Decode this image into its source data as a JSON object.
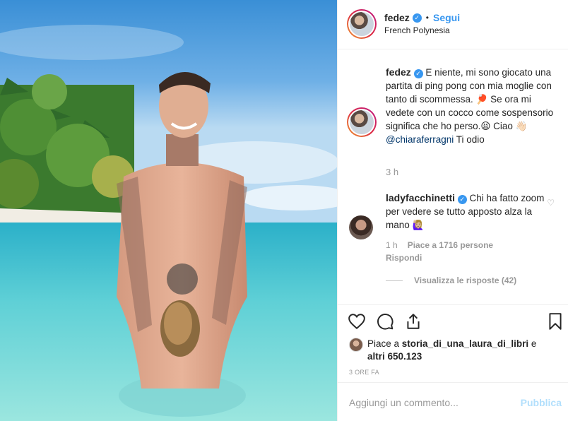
{
  "post": {
    "username": "fedez",
    "follow_label": "Segui",
    "location": "French Polynesia",
    "more_icon": "more-icon"
  },
  "caption": {
    "username": "fedez",
    "text": "E niente, mi sono giocato una partita di ping pong con mia moglie con tanto di scommessa. 🏓 Se ora mi vedete con un cocco come sospensorio significa che ho perso.😫 Ciao 👋🏻",
    "mention": "@chiaraferragni",
    "tail": " Ti odio",
    "time": "3 h"
  },
  "comment": {
    "username": "ladyfacchinetti",
    "text": " Chi ha fatto zoom per vedere se tutto apposto alza la mano 🙋🏼‍♀️",
    "time": "1 h",
    "likes": "Piace a 1716 persone",
    "reply_label": "Rispondi",
    "view_replies": "Visualizza le risposte (42)"
  },
  "likes": {
    "prefix": "Piace a ",
    "user": "storia_di_una_laura_di_libri",
    "middle": " e ",
    "others": "altri 650.123"
  },
  "post_time": "3 ORE FA",
  "add_comment": {
    "placeholder": "Aggiungi un commento...",
    "publish_label": "Pubblica"
  },
  "colors": {
    "accent": "#3897f0",
    "mention": "#003569",
    "muted": "#999999",
    "publish_disabled": "#b2dffc"
  }
}
